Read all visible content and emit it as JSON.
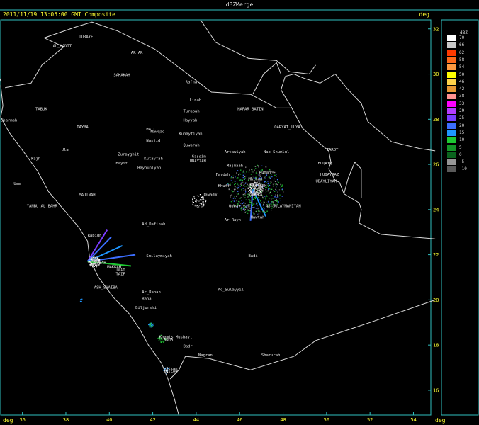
{
  "window": {
    "title": "dBZMerge"
  },
  "header": {
    "timestamp": "2011/11/19 13:05:00 GMT Composite",
    "unit_right": "deg"
  },
  "axes": {
    "x_unit": "deg",
    "y_unit": "deg",
    "x_ticks": [
      "36",
      "38",
      "40",
      "42",
      "44",
      "46",
      "48",
      "50",
      "52",
      "54"
    ],
    "y_ticks": [
      "32",
      "30",
      "28",
      "26",
      "24",
      "22",
      "20",
      "18",
      "16"
    ],
    "x_range": [
      35.0,
      54.8
    ],
    "y_range": [
      14.9,
      32.4
    ]
  },
  "legend": {
    "unit": "dBZ",
    "entries": [
      {
        "label": "70",
        "color": "#ffffff"
      },
      {
        "label": "66",
        "color": "#c8c8c8"
      },
      {
        "label": "62",
        "color": "#ff3a00"
      },
      {
        "label": "58",
        "color": "#ff6a1a"
      },
      {
        "label": "54",
        "color": "#ff9a40"
      },
      {
        "label": "50",
        "color": "#ffff00"
      },
      {
        "label": "46",
        "color": "#ffd24a"
      },
      {
        "label": "42",
        "color": "#e69632"
      },
      {
        "label": "38",
        "color": "#ff9090"
      },
      {
        "label": "33",
        "color": "#ff00ff"
      },
      {
        "label": "29",
        "color": "#b43cff"
      },
      {
        "label": "25",
        "color": "#7a3cff"
      },
      {
        "label": "20",
        "color": "#3c6eff"
      },
      {
        "label": "15",
        "color": "#1e96ff"
      },
      {
        "label": "10",
        "color": "#1ec832"
      },
      {
        "label": "5",
        "color": "#149628"
      },
      {
        "label": "0",
        "color": "#0a641e"
      },
      {
        "label": "-5",
        "color": "#969696"
      },
      {
        "label": "-10",
        "color": "#5a5a5a"
      }
    ]
  },
  "places": [
    {
      "name": "TURAYF",
      "lon": 38.6,
      "lat": 31.6
    },
    {
      "name": "AL_HADIT",
      "lon": 37.4,
      "lat": 31.2
    },
    {
      "name": "AR_AR",
      "lon": 41.0,
      "lat": 30.9
    },
    {
      "name": "SAKAKAH",
      "lon": 40.2,
      "lat": 29.9
    },
    {
      "name": "Rafha",
      "lon": 43.5,
      "lat": 29.6
    },
    {
      "name": "Linah",
      "lon": 43.7,
      "lat": 28.8
    },
    {
      "name": "TABUK",
      "lon": 36.6,
      "lat": 28.4
    },
    {
      "name": "Sharmah",
      "lon": 35.0,
      "lat": 27.9
    },
    {
      "name": "HAFAR_BATIN",
      "lon": 45.9,
      "lat": 28.4
    },
    {
      "name": "Turabah",
      "lon": 43.4,
      "lat": 28.3
    },
    {
      "name": "Hayyah",
      "lon": 43.4,
      "lat": 27.9
    },
    {
      "name": "QARYAT_ULYA",
      "lon": 47.6,
      "lat": 27.6
    },
    {
      "name": "TAYMA",
      "lon": 38.5,
      "lat": 27.6
    },
    {
      "name": "Mawqaq",
      "lon": 41.9,
      "lat": 27.4
    },
    {
      "name": "HAIL",
      "lon": 41.7,
      "lat": 27.5
    },
    {
      "name": "Kuhayfiyah",
      "lon": 43.2,
      "lat": 27.3
    },
    {
      "name": "Nasjid",
      "lon": 41.7,
      "lat": 27.0
    },
    {
      "name": "Quwarah",
      "lon": 43.4,
      "lat": 26.8
    },
    {
      "name": "Ula",
      "lon": 37.8,
      "lat": 26.6
    },
    {
      "name": "Wajh",
      "lon": 36.4,
      "lat": 26.2
    },
    {
      "name": "Zurayghit",
      "lon": 40.4,
      "lat": 26.4
    },
    {
      "name": "Kutayfah",
      "lon": 41.6,
      "lat": 26.2
    },
    {
      "name": "Gassim",
      "lon": 43.8,
      "lat": 26.3
    },
    {
      "name": "UNAYZAH",
      "lon": 43.7,
      "lat": 26.1
    },
    {
      "name": "Artawiyah",
      "lon": 45.3,
      "lat": 26.5
    },
    {
      "name": "Nab_Shumlul",
      "lon": 47.1,
      "lat": 26.5
    },
    {
      "name": "TAROT",
      "lon": 50.0,
      "lat": 26.6
    },
    {
      "name": "Hayit",
      "lon": 40.3,
      "lat": 26.0
    },
    {
      "name": "Hayouniyah",
      "lon": 41.3,
      "lat": 25.8
    },
    {
      "name": "Majmaah",
      "lon": 45.4,
      "lat": 25.9
    },
    {
      "name": "BUQAYQ",
      "lon": 49.6,
      "lat": 26.0
    },
    {
      "name": "Rumah",
      "lon": 46.9,
      "lat": 25.6
    },
    {
      "name": "HUBAYRAZ",
      "lon": 49.7,
      "lat": 25.5
    },
    {
      "name": "Faydah",
      "lon": 44.9,
      "lat": 25.5
    },
    {
      "name": "Umm",
      "lon": 35.6,
      "lat": 25.1
    },
    {
      "name": "Malham",
      "lon": 46.4,
      "lat": 25.3
    },
    {
      "name": "UDAYLIYAH",
      "lon": 49.5,
      "lat": 25.2
    },
    {
      "name": "Khuff",
      "lon": 45.0,
      "lat": 25.0
    },
    {
      "name": "RIYADH",
      "lon": 46.6,
      "lat": 25.0
    },
    {
      "name": "Dawadmi",
      "lon": 44.3,
      "lat": 24.6
    },
    {
      "name": "MADINAH",
      "lon": 38.6,
      "lat": 24.6
    },
    {
      "name": "RAFIKA",
      "lon": 46.4,
      "lat": 24.6
    },
    {
      "name": "AS_SULAYMANIYAH",
      "lon": 47.2,
      "lat": 24.1
    },
    {
      "name": "YANBU_AL_BAHR",
      "lon": 36.2,
      "lat": 24.1
    },
    {
      "name": "Quwayiyah",
      "lon": 45.5,
      "lat": 24.1
    },
    {
      "name": "Ar_Rayn",
      "lon": 45.3,
      "lat": 23.5
    },
    {
      "name": "Hawtah",
      "lon": 46.5,
      "lat": 23.6
    },
    {
      "name": "Ad_Dafinah",
      "lon": 41.5,
      "lat": 23.3
    },
    {
      "name": "Rabigh",
      "lon": 39.0,
      "lat": 22.8
    },
    {
      "name": "Badi",
      "lon": 46.4,
      "lat": 21.9
    },
    {
      "name": "Smilaymiyah",
      "lon": 41.7,
      "lat": 21.9
    },
    {
      "name": "JEDDAH",
      "lon": 39.2,
      "lat": 21.6
    },
    {
      "name": "MAKKAH",
      "lon": 39.9,
      "lat": 21.4
    },
    {
      "name": "Taif",
      "lon": 40.3,
      "lat": 21.3
    },
    {
      "name": "TAIF",
      "lon": 40.3,
      "lat": 21.1
    },
    {
      "name": "ASH_SHAIBA",
      "lon": 39.3,
      "lat": 20.5
    },
    {
      "name": "Ar_Rahah",
      "lon": 41.5,
      "lat": 20.3
    },
    {
      "name": "Ac_Sulayyil",
      "lon": 45.0,
      "lat": 20.4
    },
    {
      "name": "Baha",
      "lon": 41.5,
      "lat": 20.0
    },
    {
      "name": "Biljurshi",
      "lon": 41.2,
      "lat": 19.6
    },
    {
      "name": "Khamis_Mushayt",
      "lon": 42.3,
      "lat": 18.3
    },
    {
      "name": "ABHA",
      "lon": 42.5,
      "lat": 18.2
    },
    {
      "name": "Badr",
      "lon": 43.4,
      "lat": 17.9
    },
    {
      "name": "Nagran",
      "lon": 44.1,
      "lat": 17.5
    },
    {
      "name": "Sharurah",
      "lon": 47.0,
      "lat": 17.5
    },
    {
      "name": "Jizan",
      "lon": 42.6,
      "lat": 16.9
    },
    {
      "name": "JIZAN",
      "lon": 42.6,
      "lat": 16.8
    }
  ],
  "borders": [
    [
      [
        35.2,
        29.4
      ],
      [
        36.4,
        29.6
      ],
      [
        36.9,
        30.4
      ],
      [
        37.9,
        31.2
      ],
      [
        37.0,
        31.6
      ],
      [
        38.5,
        32.1
      ],
      [
        39.2,
        32.3
      ],
      [
        40.4,
        31.9
      ],
      [
        42.1,
        31.1
      ],
      [
        44.7,
        29.2
      ],
      [
        46.5,
        29.1
      ],
      [
        47.7,
        28.5
      ],
      [
        48.4,
        28.5
      ]
    ],
    [
      [
        48.4,
        28.5
      ],
      [
        47.9,
        29.3
      ],
      [
        48.1,
        29.9
      ]
    ],
    [
      [
        44.2,
        32.4
      ],
      [
        44.9,
        31.4
      ],
      [
        46.4,
        30.7
      ],
      [
        47.7,
        30.6
      ],
      [
        48.3,
        30.1
      ],
      [
        49.2,
        30.0
      ],
      [
        49.5,
        30.4
      ]
    ],
    [
      [
        47.9,
        30.0
      ],
      [
        47.7,
        30.5
      ],
      [
        47.1,
        30.0
      ],
      [
        46.6,
        29.1
      ]
    ],
    [
      [
        50.6,
        25.2
      ],
      [
        50.8,
        24.7
      ],
      [
        51.5,
        24.3
      ],
      [
        51.6,
        24.0
      ],
      [
        51.5,
        23.4
      ],
      [
        52.5,
        22.9
      ],
      [
        55.0,
        22.7
      ]
    ],
    [
      [
        55.0,
        20.0
      ],
      [
        52.0,
        19.0
      ],
      [
        49.5,
        18.2
      ],
      [
        48.5,
        17.5
      ],
      [
        46.5,
        16.9
      ],
      [
        44.6,
        17.4
      ],
      [
        43.5,
        17.5
      ],
      [
        43.2,
        16.9
      ],
      [
        42.8,
        16.5
      ]
    ]
  ],
  "coasts": [
    [
      [
        35.0,
        28.1
      ],
      [
        35.4,
        27.4
      ],
      [
        36.1,
        26.5
      ],
      [
        36.7,
        25.7
      ],
      [
        37.2,
        24.8
      ],
      [
        37.9,
        24.0
      ],
      [
        38.6,
        23.2
      ],
      [
        39.0,
        22.6
      ],
      [
        39.1,
        21.8
      ],
      [
        39.5,
        21.0
      ],
      [
        40.2,
        20.1
      ],
      [
        40.9,
        19.4
      ],
      [
        41.4,
        18.7
      ],
      [
        41.8,
        18.0
      ],
      [
        42.4,
        17.2
      ],
      [
        42.7,
        16.5
      ],
      [
        43.0,
        15.6
      ],
      [
        43.2,
        14.9
      ]
    ],
    [
      [
        35.0,
        29.8
      ],
      [
        34.9,
        29.5
      ]
    ],
    [
      [
        35.0,
        29.5
      ],
      [
        35.1,
        28.6
      ],
      [
        35.0,
        28.1
      ]
    ],
    [
      [
        48.4,
        28.5
      ],
      [
        48.9,
        27.6
      ],
      [
        49.6,
        27.0
      ],
      [
        50.1,
        26.6
      ],
      [
        50.2,
        26.1
      ],
      [
        50.1,
        25.8
      ],
      [
        50.4,
        25.3
      ],
      [
        50.6,
        25.2
      ]
    ],
    [
      [
        50.4,
        30.0
      ],
      [
        51.0,
        29.3
      ],
      [
        51.6,
        28.7
      ],
      [
        51.9,
        27.9
      ],
      [
        53.0,
        27.0
      ],
      [
        54.3,
        26.7
      ],
      [
        55.0,
        26.6
      ]
    ],
    [
      [
        48.1,
        29.9
      ],
      [
        48.5,
        30.0
      ],
      [
        49.0,
        29.8
      ],
      [
        49.7,
        29.6
      ],
      [
        50.4,
        30.0
      ]
    ],
    [
      [
        50.8,
        24.7
      ],
      [
        51.0,
        25.4
      ],
      [
        51.3,
        26.1
      ],
      [
        51.6,
        25.8
      ],
      [
        51.6,
        25.2
      ],
      [
        51.6,
        24.5
      ]
    ]
  ],
  "radar_clusters": [
    {
      "lon": 46.7,
      "lat": 24.9,
      "r": 1.3,
      "n": 520,
      "colors": [
        "#149628",
        "#1ec832",
        "#969696",
        "#5a5a5a",
        "#3c6eff"
      ]
    },
    {
      "lon": 46.7,
      "lat": 24.95,
      "r": 0.35,
      "n": 160,
      "colors": [
        "#ffffff",
        "#c8c8c8",
        "#969696"
      ]
    },
    {
      "lon": 39.3,
      "lat": 21.7,
      "r": 0.28,
      "n": 140,
      "colors": [
        "#ffffff",
        "#c8c8c8",
        "#969696"
      ]
    },
    {
      "lon": 44.1,
      "lat": 24.4,
      "r": 0.35,
      "n": 60,
      "colors": [
        "#ffffff",
        "#969696"
      ]
    },
    {
      "lon": 41.9,
      "lat": 18.9,
      "r": 0.12,
      "n": 30,
      "colors": [
        "#1ec832",
        "#1e96ff"
      ]
    },
    {
      "lon": 42.4,
      "lat": 18.3,
      "r": 0.2,
      "n": 30,
      "colors": [
        "#149628",
        "#1ec832"
      ]
    },
    {
      "lon": 42.6,
      "lat": 16.9,
      "r": 0.15,
      "n": 25,
      "colors": [
        "#1e96ff",
        "#ffffff"
      ]
    },
    {
      "lon": 38.7,
      "lat": 20.0,
      "r": 0.08,
      "n": 6,
      "colors": [
        "#1e96ff"
      ]
    }
  ],
  "radar_rays": [
    {
      "lon": 39.0,
      "lat": 21.7,
      "lon2": 39.9,
      "lat2": 23.1,
      "color": "#7a3cff"
    },
    {
      "lon": 39.0,
      "lat": 21.7,
      "lon2": 40.1,
      "lat2": 22.8,
      "color": "#3c6eff"
    },
    {
      "lon": 39.0,
      "lat": 21.7,
      "lon2": 40.6,
      "lat2": 22.4,
      "color": "#1e96ff"
    },
    {
      "lon": 39.0,
      "lat": 21.7,
      "lon2": 41.2,
      "lat2": 22.0,
      "color": "#3c6eff"
    },
    {
      "lon": 39.0,
      "lat": 21.7,
      "lon2": 41.0,
      "lat2": 21.5,
      "color": "#1ec832"
    },
    {
      "lon": 46.6,
      "lat": 24.9,
      "lon2": 46.5,
      "lat2": 23.5,
      "color": "#3c6eff"
    },
    {
      "lon": 46.6,
      "lat": 24.9,
      "lon2": 47.2,
      "lat2": 23.7,
      "color": "#1e96ff"
    }
  ]
}
